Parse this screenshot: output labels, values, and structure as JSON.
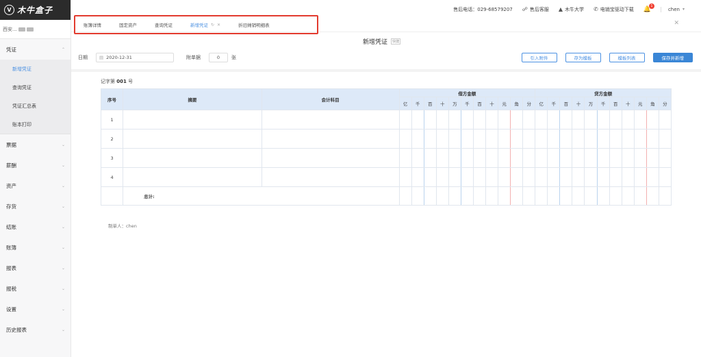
{
  "app": {
    "logo_mark": "V",
    "logo_text": "木牛盒子",
    "company": "西安...",
    "colors": {
      "accent": "#4a90e2",
      "primary_button": "#3a86d6",
      "highlight_box": "#e23a2e",
      "table_header": "#dde9f8"
    }
  },
  "sidebar": {
    "groups": [
      {
        "label": "凭证",
        "expanded": true,
        "items": [
          {
            "label": "新增凭证",
            "active": true
          },
          {
            "label": "查询凭证"
          },
          {
            "label": "凭证汇总表"
          },
          {
            "label": "账本打印"
          }
        ]
      },
      {
        "label": "票据"
      },
      {
        "label": "薪酬"
      },
      {
        "label": "资产"
      },
      {
        "label": "存货"
      },
      {
        "label": "结账"
      },
      {
        "label": "账簿"
      },
      {
        "label": "报表"
      },
      {
        "label": "报税"
      },
      {
        "label": "设置"
      },
      {
        "label": "历史报表"
      }
    ]
  },
  "topbar": {
    "phone": "售后电话：029-68579207",
    "service": "售后客服",
    "university": "木牛大学",
    "download": "电销宝驱动下载",
    "notification_count": "1",
    "user": "chen"
  },
  "tabs": [
    {
      "label": "账簿详情"
    },
    {
      "label": "固定资产"
    },
    {
      "label": "查询凭证"
    },
    {
      "label": "新增凭证",
      "active": true
    },
    {
      "label": "折旧摊销明细表"
    }
  ],
  "page": {
    "title": "新增凭证",
    "title_badge": "快捷",
    "date_label": "日期",
    "date_value": "2020-12-31",
    "attachments_label": "附单据",
    "attachments_value": "0",
    "attachments_unit": "张",
    "buttons": {
      "import": "引入附件",
      "save_template": "存为模板",
      "template_list": "模板列表",
      "save_and_new": "保存并新增"
    },
    "voucher_prefix": "记字第",
    "voucher_number": "001",
    "voucher_suffix": "号",
    "maker": "制单人：chen"
  },
  "table": {
    "headers": {
      "seq": "序号",
      "summary": "摘要",
      "account": "会计科目",
      "debit": "借方金额",
      "credit": "贷方金额"
    },
    "digit_units": [
      "亿",
      "千",
      "百",
      "十",
      "万",
      "千",
      "百",
      "十",
      "元",
      "角",
      "分"
    ],
    "rows": [
      "1",
      "2",
      "3",
      "4"
    ],
    "total_label": "总计:"
  }
}
